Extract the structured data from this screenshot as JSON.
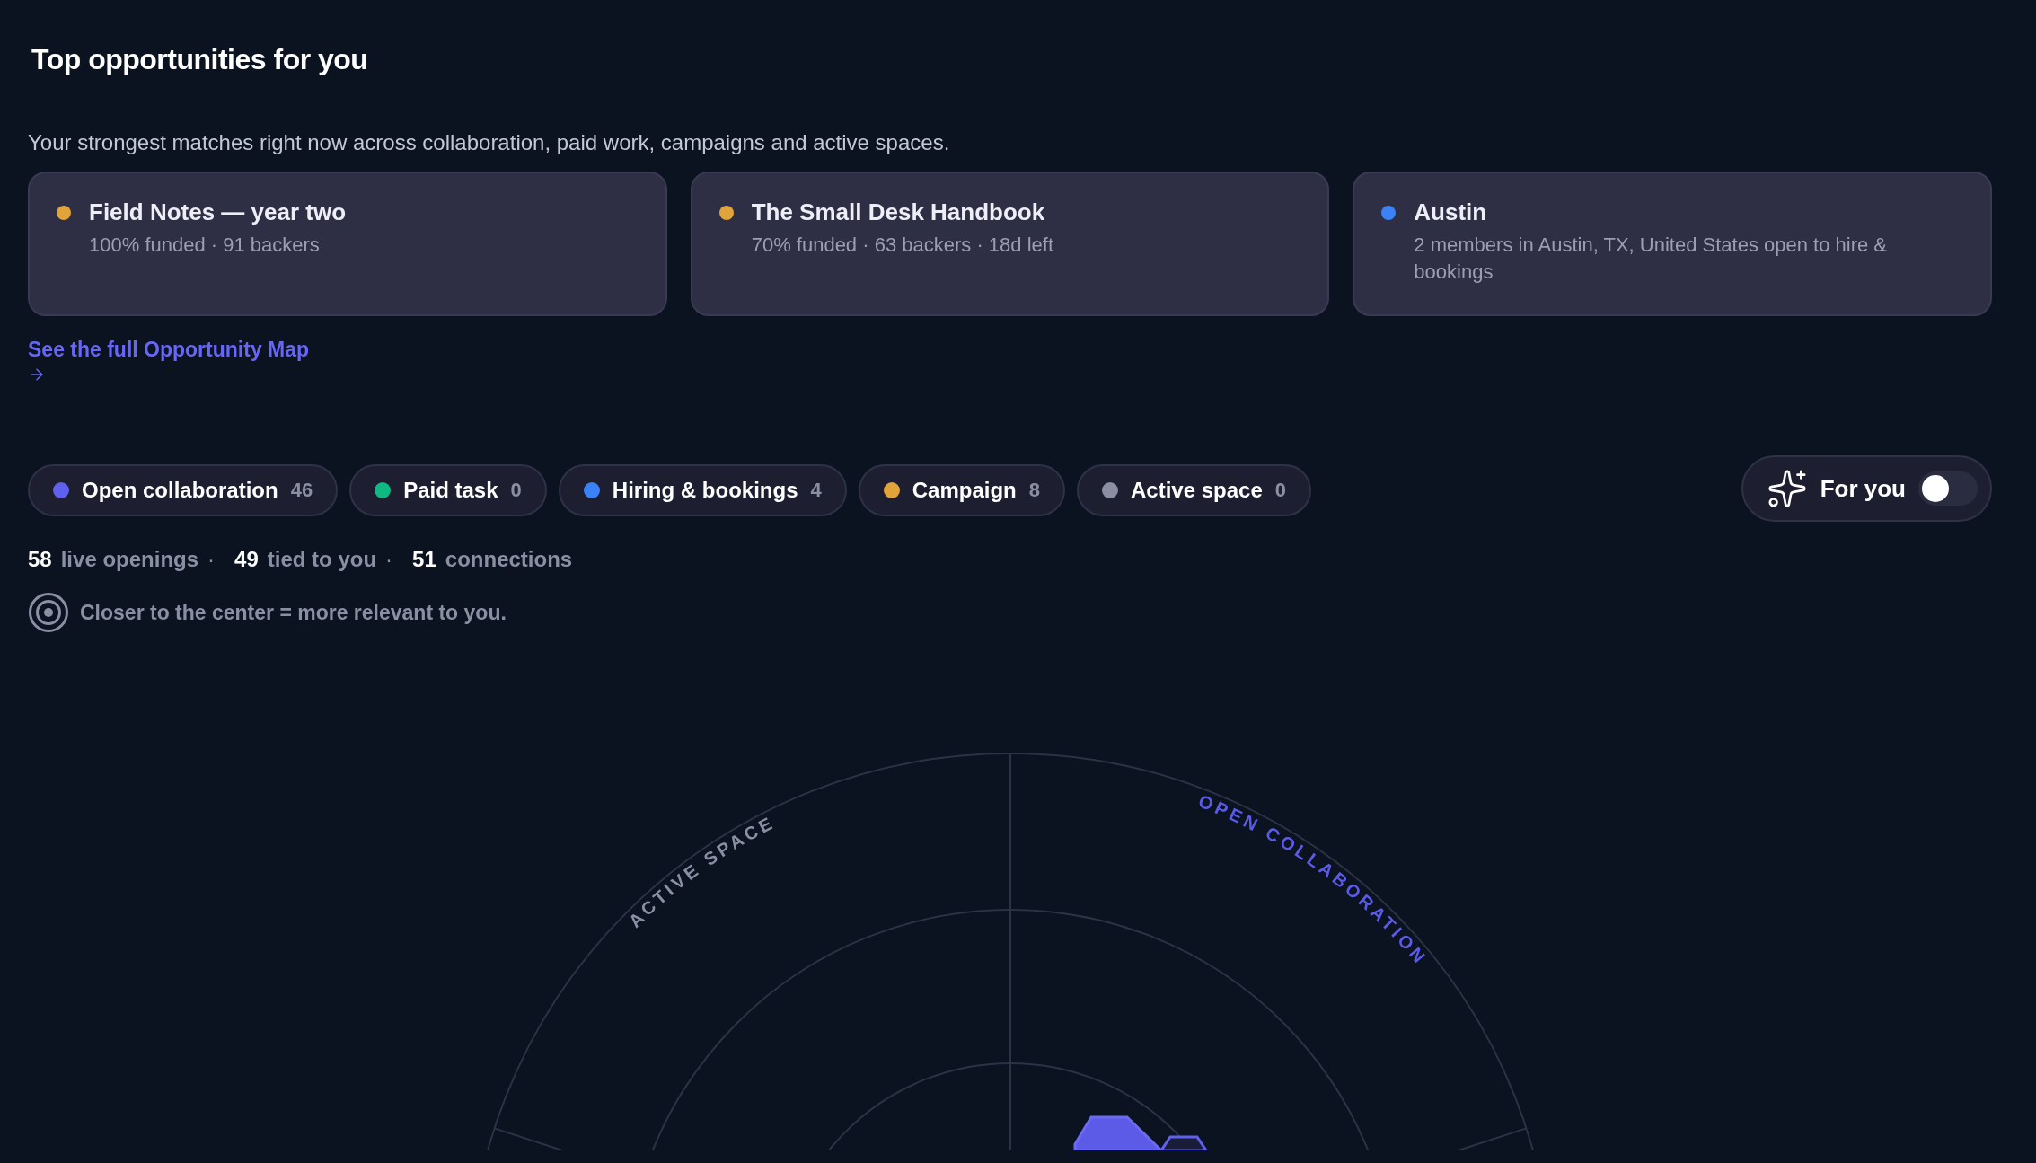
{
  "heading": "Top opportunities for you",
  "subtitle": "Your strongest matches right now across collaboration, paid work, campaigns and active spaces.",
  "cards": [
    {
      "title": "Field Notes — year two",
      "detail": "100% funded · 91 backers",
      "color": "#e0a43a"
    },
    {
      "title": "The Small Desk Handbook",
      "detail": "70% funded · 63 backers · 18d left",
      "color": "#e0a43a"
    },
    {
      "title": "Austin",
      "detail": "2 members in Austin, TX, United States open to hire & bookings",
      "color": "#3b82f6"
    }
  ],
  "map_link": {
    "label": "See the full Opportunity Map"
  },
  "filters": [
    {
      "label": "Open collaboration",
      "count": "46",
      "color": "#6060ee"
    },
    {
      "label": "Paid task",
      "count": "0",
      "color": "#10b981"
    },
    {
      "label": "Hiring & bookings",
      "count": "4",
      "color": "#3b82f6"
    },
    {
      "label": "Campaign",
      "count": "8",
      "color": "#e0a43a"
    },
    {
      "label": "Active space",
      "count": "0",
      "color": "#8b8fa3"
    }
  ],
  "for_you": {
    "label": "For you",
    "on": false
  },
  "stats": [
    {
      "number": "58",
      "text": "live openings"
    },
    {
      "sep": "·",
      "number": "49",
      "text": "tied to you"
    },
    {
      "sep": "·",
      "number": "51",
      "text": "connections"
    }
  ],
  "hint": "Closer to the center = more relevant to you.",
  "radar": {
    "sectors": [
      {
        "label": "ACTIVE SPACE",
        "color": "#8b8fa3"
      },
      {
        "label": "OPEN COLLABORATION",
        "color": "#5b5be8"
      }
    ]
  }
}
